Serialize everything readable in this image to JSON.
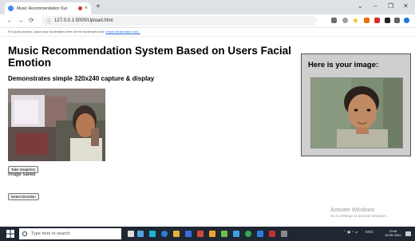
{
  "browser": {
    "tab_title": "Music Recommendation Sys",
    "tab_close": "×",
    "new_tab": "+",
    "window_controls": {
      "chevron": "⌄",
      "minimize": "–",
      "restore": "❐",
      "close": "✕"
    },
    "nav": {
      "back": "←",
      "forward": "→",
      "reload": "⟳",
      "info": "ⓘ"
    },
    "url": "127.0.0.1:5000/Upload.html",
    "bookmarks_bar_text": "For quick access, place your bookmarks here on the bookmarks bar.",
    "bookmarks_link": "Import bookmarks now..."
  },
  "page": {
    "title": "Music Recommendation System Based on Users Facial Emotion",
    "subtitle": "Demonstrates simple 320x240 capture & display",
    "snapshot_button": "Take Snapshot",
    "status_text": "Image saved",
    "detect_button": "Detect Emotion",
    "panel_title": "Here is your image:"
  },
  "watermark": {
    "line1": "Activate Windows",
    "line2": "Go to Settings to activate Windows."
  },
  "taskbar": {
    "search_placeholder": "Type here to search",
    "time": "13:46",
    "date": "18-05-2022",
    "language": "ENG"
  },
  "colors": {
    "tabstrip": "#dee1e6",
    "taskbar": "#1f2733",
    "panel_bg": "#cfcfcf",
    "link": "#1a73e8",
    "recording_dot": "#d93025"
  }
}
